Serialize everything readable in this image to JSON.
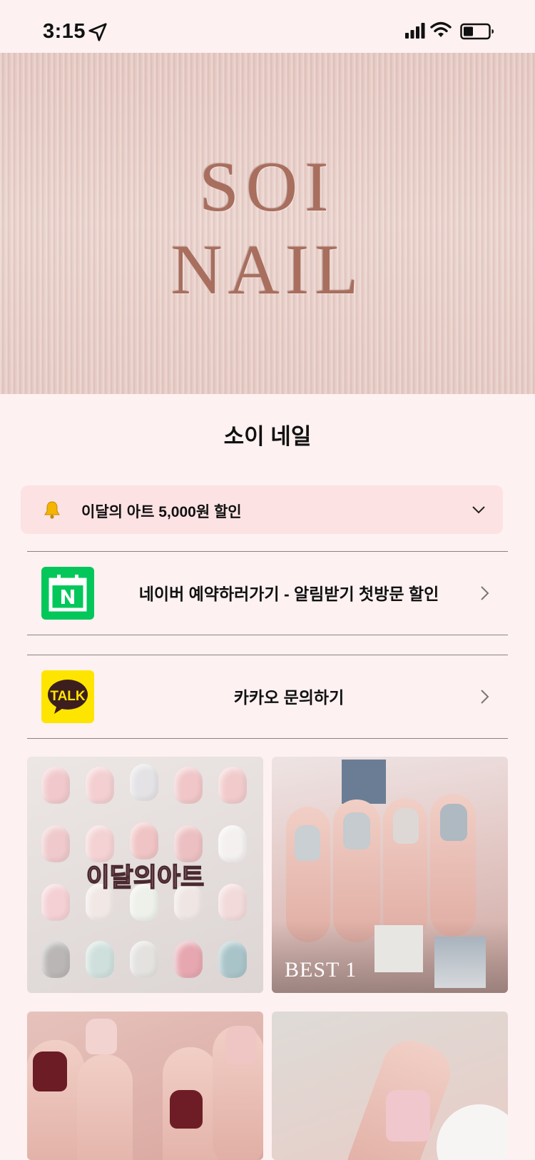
{
  "status_bar": {
    "time": "3:15"
  },
  "hero": {
    "logo_line1": "SOI",
    "logo_line2": "NAIL"
  },
  "page_title": "소이 네일",
  "notice": {
    "text": "이달의 아트 5,000원 할인"
  },
  "links": [
    {
      "label": "네이버 예약하러가기 - 알림받기 첫방문 할인",
      "icon": "naver-calendar-icon"
    },
    {
      "label": "카카오 문의하기",
      "icon": "kakao-talk-icon",
      "icon_text": "TALK"
    }
  ],
  "gallery": [
    {
      "caption": "이달의아트"
    },
    {
      "caption": "BEST 1"
    },
    {
      "caption": ""
    },
    {
      "caption": ""
    }
  ],
  "colors": {
    "background": "#fdf1f1",
    "notice_bg": "#fde2e3",
    "naver_green": "#03c75a",
    "kakao_yellow": "#fee500",
    "logo_rose_gold": "#a86e5e"
  }
}
